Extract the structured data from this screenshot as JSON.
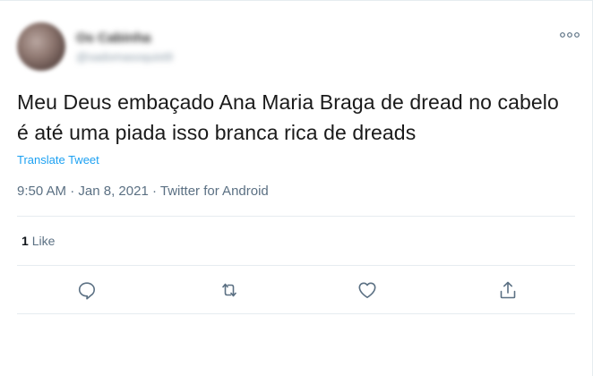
{
  "user": {
    "name": "Os Cabinha",
    "handle": "@sadomasoquist9"
  },
  "tweet": {
    "text": "Meu Deus embaçado Ana Maria Braga de dread no cabelo é até uma piada isso branca rica de dreads",
    "translate_label": "Translate Tweet",
    "time": "9:50 AM",
    "date": "Jan 8, 2021",
    "source": "Twitter for Android",
    "separator": "·"
  },
  "stats": {
    "likes_count": "1",
    "likes_label": "Like"
  },
  "icons": {
    "more": "more-icon",
    "reply": "reply-icon",
    "retweet": "retweet-icon",
    "like": "heart-icon",
    "share": "share-icon"
  },
  "colors": {
    "accent": "#1da1f2",
    "muted": "#5b7083",
    "divider": "#e6ecf0",
    "text": "#0f1419"
  }
}
